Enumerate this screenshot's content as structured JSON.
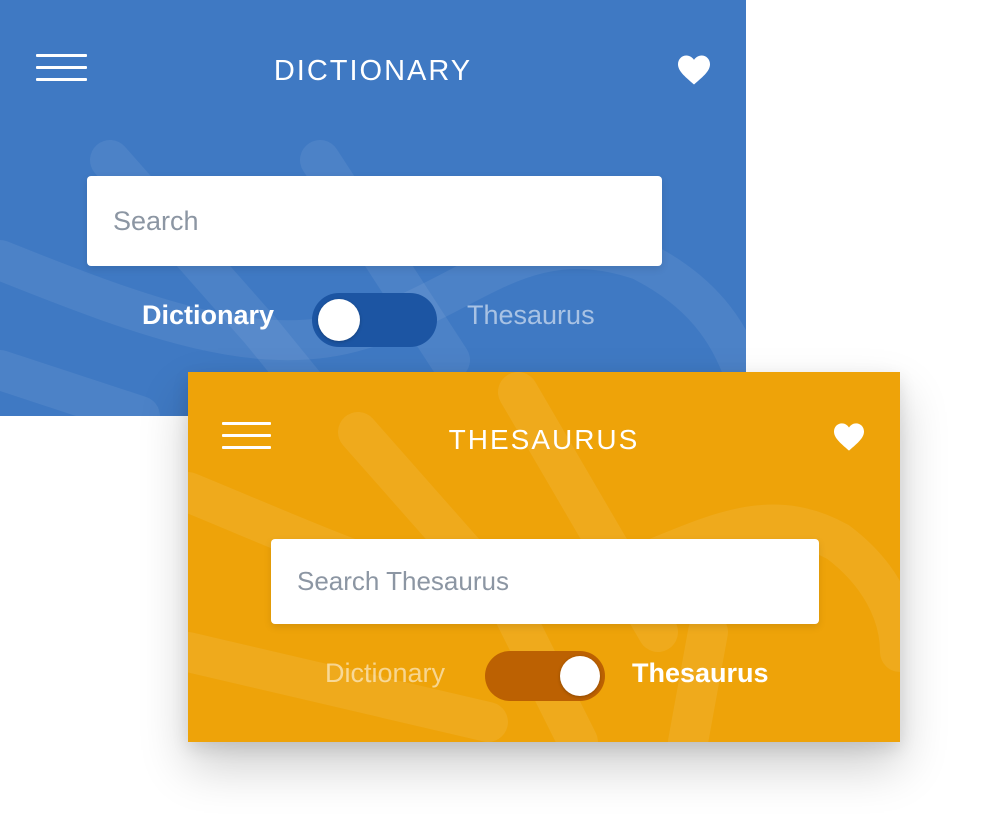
{
  "dictionary_card": {
    "title": "DICTIONARY",
    "search_placeholder": "Search",
    "toggle_left_label": "Dictionary",
    "toggle_right_label": "Thesaurus",
    "toggle_state": "Dictionary",
    "background_color": "#3f79c3",
    "switch_color": "#1c55a3",
    "icons": {
      "menu": "hamburger-menu-icon",
      "favorite": "heart-icon"
    }
  },
  "thesaurus_card": {
    "title": "THESAURUS",
    "search_placeholder": "Search Thesaurus",
    "toggle_left_label": "Dictionary",
    "toggle_right_label": "Thesaurus",
    "toggle_state": "Thesaurus",
    "background_color": "#eea309",
    "switch_color": "#bc6102",
    "icons": {
      "menu": "hamburger-menu-icon",
      "favorite": "heart-icon"
    }
  }
}
